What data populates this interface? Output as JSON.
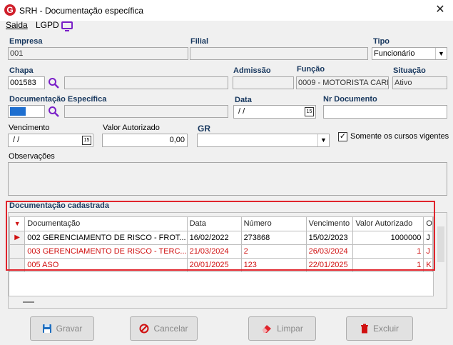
{
  "window": {
    "title": "SRH - Documentação específica",
    "close": "✕",
    "logo": "G"
  },
  "menu": [
    {
      "label": "Saida"
    },
    {
      "label": "LGPD"
    }
  ],
  "labels": {
    "empresa": "Empresa",
    "filial": "Filial",
    "tipo": "Tipo",
    "chapa": "Chapa",
    "admissao": "Admissão",
    "funcao": "Função",
    "situacao": "Situação",
    "doc_especifica": "Documentação Específica",
    "data": "Data",
    "nr_documento": "Nr Documento",
    "vencimento": "Vencimento",
    "valor_autorizado": "Valor Autorizado",
    "gr": "GR",
    "somente_cursos": "Somente os cursos vigentes",
    "observacoes": "Observações",
    "doc_cadastrada": "Documentação cadastrada"
  },
  "fields": {
    "empresa_code": "001",
    "empresa_name": "",
    "filial_name": "",
    "tipo": "Funcionário",
    "chapa": "001583",
    "chapa_name": "",
    "admissao": "",
    "funcao": "0009 - MOTORISTA CARR",
    "situacao": "Ativo",
    "data": " / /",
    "nr_documento": "",
    "vencimento": " / /",
    "valor_autorizado": "0,00",
    "gr": "",
    "somente_cursos_checked": "✓"
  },
  "grid": {
    "columns": [
      "Documentação",
      "Data",
      "Número",
      "Vencimento",
      "Valor Autorizado",
      "O"
    ],
    "rows": [
      {
        "doc": "002 GERENCIAMENTO DE RISCO - FROT...",
        "data": "16/02/2022",
        "numero": "273868",
        "vencimento": "15/02/2023",
        "valor": "1000000",
        "o": "J",
        "red": false,
        "current": true
      },
      {
        "doc": "003 GERENCIAMENTO DE RISCO - TERC...",
        "data": "21/03/2024",
        "numero": "2",
        "vencimento": "26/03/2024",
        "valor": "1",
        "o": "J",
        "red": true,
        "current": false
      },
      {
        "doc": "005 ASO",
        "data": "20/01/2025",
        "numero": "123",
        "vencimento": "22/01/2025",
        "valor": "1",
        "o": "K",
        "red": true,
        "current": false
      }
    ]
  },
  "buttons": {
    "gravar": "Gravar",
    "cancelar": "Cancelar",
    "limpar": "Limpar",
    "excluir": "Excluir"
  },
  "colors": {
    "label_blue": "#17375e",
    "highlight_red": "#e0242c",
    "row_red": "#d01010",
    "accent_purple": "#7a20c8"
  }
}
